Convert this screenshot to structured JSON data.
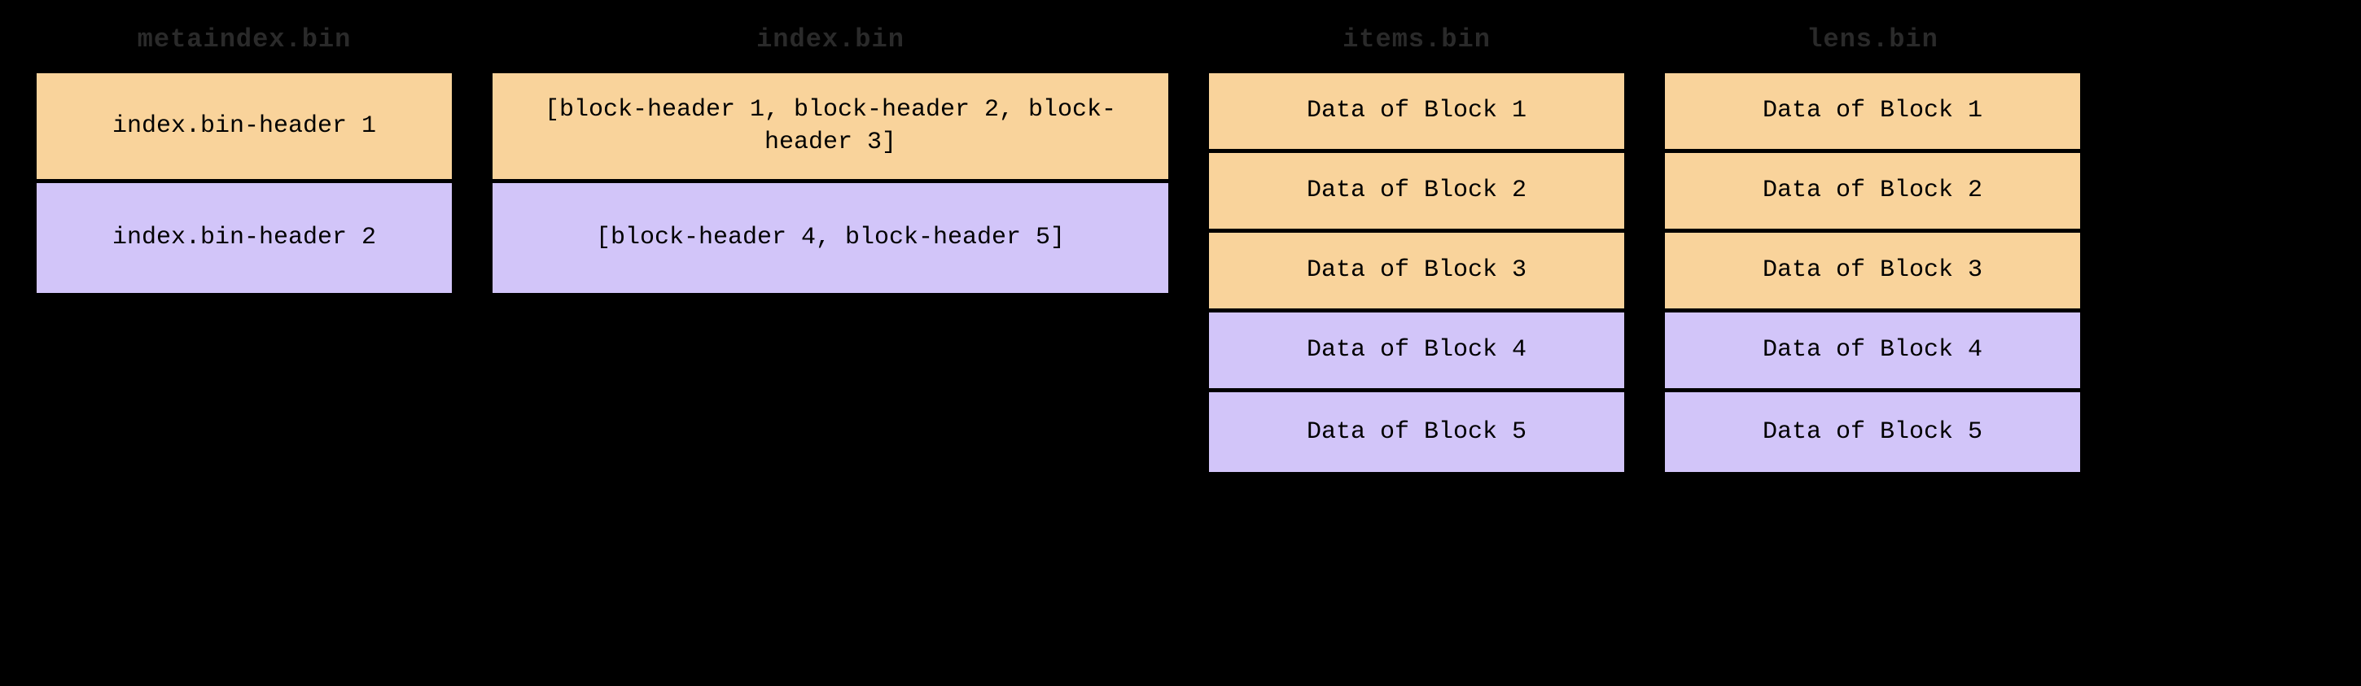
{
  "columns": {
    "metaindex": {
      "title": "metaindex.bin",
      "cells": [
        {
          "text": "index.bin-header 1",
          "color": "orange"
        },
        {
          "text": "index.bin-header 2",
          "color": "purple"
        }
      ]
    },
    "index": {
      "title": "index.bin",
      "cells": [
        {
          "text": "[block-header 1, block-header 2, block-header 3]",
          "color": "orange"
        },
        {
          "text": "[block-header 4, block-header 5]",
          "color": "purple"
        }
      ]
    },
    "items": {
      "title": "items.bin",
      "cells": [
        {
          "text": "Data of Block 1",
          "color": "orange"
        },
        {
          "text": "Data of Block 2",
          "color": "orange"
        },
        {
          "text": "Data of Block 3",
          "color": "orange"
        },
        {
          "text": "Data of Block 4",
          "color": "purple"
        },
        {
          "text": "Data of Block 5",
          "color": "purple"
        }
      ]
    },
    "lens": {
      "title": "lens.bin",
      "cells": [
        {
          "text": "Data of Block 1",
          "color": "orange"
        },
        {
          "text": "Data of Block 2",
          "color": "orange"
        },
        {
          "text": "Data of Block 3",
          "color": "orange"
        },
        {
          "text": "Data of Block 4",
          "color": "purple"
        },
        {
          "text": "Data of Block 5",
          "color": "purple"
        }
      ]
    }
  }
}
